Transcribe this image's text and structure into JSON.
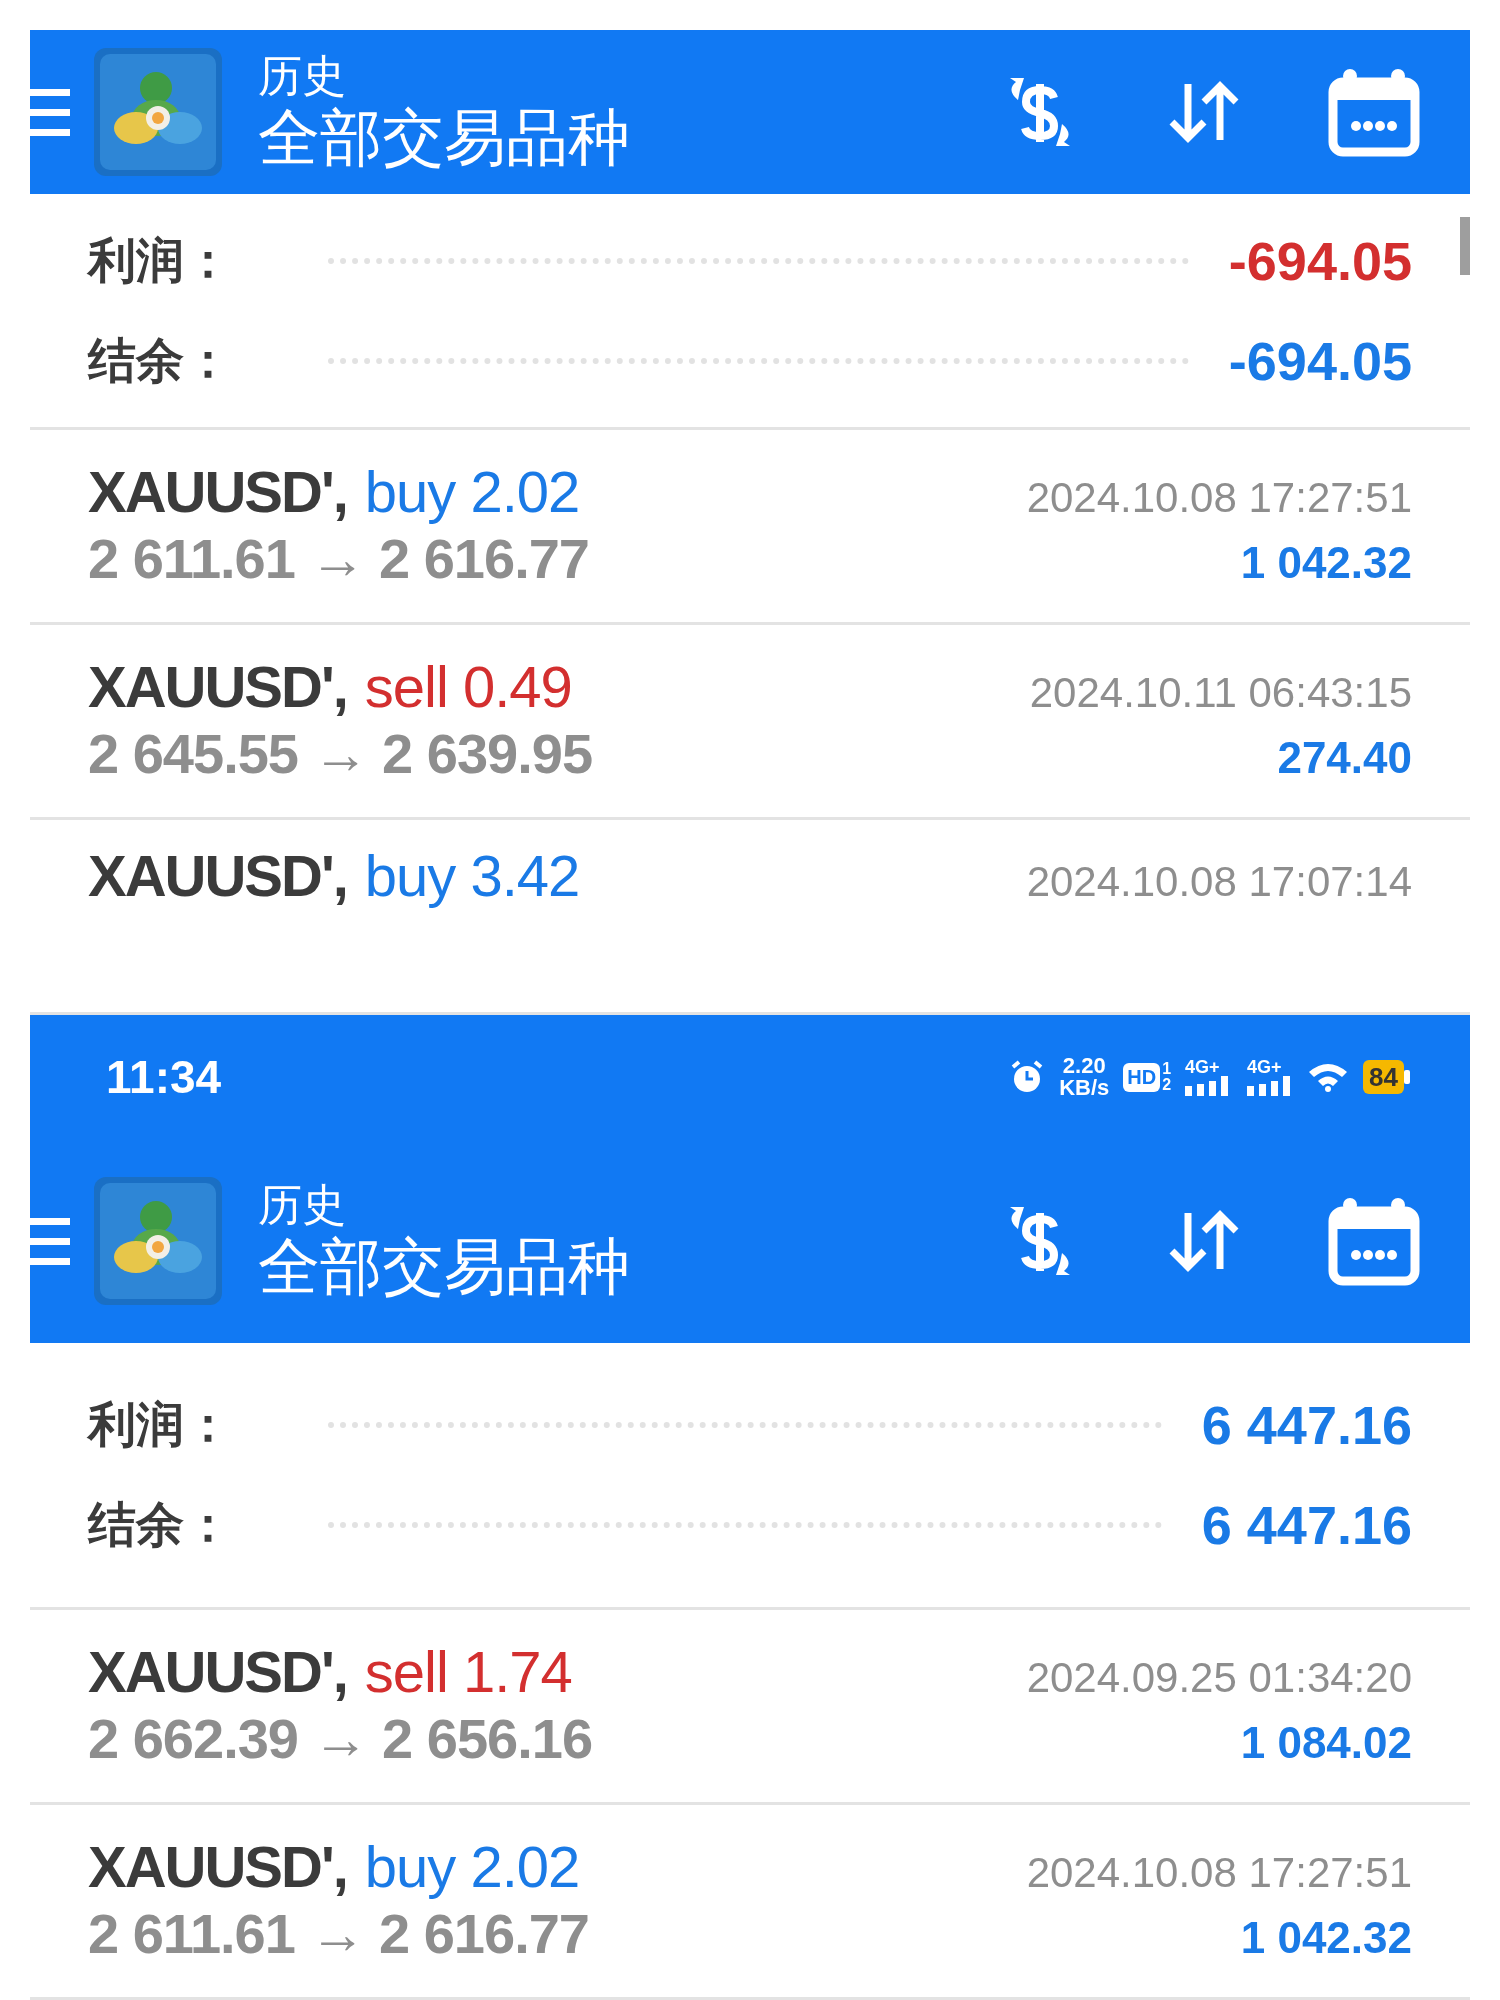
{
  "screens": [
    {
      "header": {
        "title": "历史",
        "subtitle": "全部交易品种"
      },
      "summary": [
        {
          "label": "利润：",
          "value": "-694.05",
          "color": "#d32f2f"
        },
        {
          "label": "结余：",
          "value": "-694.05",
          "color": "#1a7ae6"
        }
      ],
      "trades": [
        {
          "symbol": "XAUUSD',",
          "kind": "buy",
          "order": "buy 2.02",
          "time": "2024.10.08 17:27:51",
          "prices": "2 611.61 → 2 616.77",
          "profit": "1 042.32"
        },
        {
          "symbol": "XAUUSD',",
          "kind": "sell",
          "order": "sell 0.49",
          "time": "2024.10.11 06:43:15",
          "prices": "2 645.55 → 2 639.95",
          "profit": "274.40"
        },
        {
          "symbol": "XAUUSD',",
          "kind": "buy",
          "order": "buy 3.42",
          "time": "2024.10.08 17:07:14"
        }
      ]
    },
    {
      "status_bar": {
        "time": "11:34",
        "speed_value": "2.20",
        "speed_unit": "KB/s",
        "hd": "HD",
        "sims": [
          "1",
          "2"
        ],
        "networks": [
          "4G+",
          "4G+"
        ],
        "battery": "84"
      },
      "header": {
        "title": "历史",
        "subtitle": "全部交易品种"
      },
      "summary": [
        {
          "label": "利润：",
          "value": "6 447.16",
          "color": "#1a7ae6"
        },
        {
          "label": "结余：",
          "value": "6 447.16",
          "color": "#1a7ae6"
        }
      ],
      "trades": [
        {
          "symbol": "XAUUSD',",
          "kind": "sell",
          "order": "sell 1.74",
          "time": "2024.09.25 01:34:20",
          "prices": "2 662.39 → 2 656.16",
          "profit": "1 084.02"
        },
        {
          "symbol": "XAUUSD',",
          "kind": "buy",
          "order": "buy 2.02",
          "time": "2024.10.08 17:27:51",
          "prices": "2 611.61 → 2 616.77",
          "profit": "1 042.32"
        }
      ]
    }
  ]
}
